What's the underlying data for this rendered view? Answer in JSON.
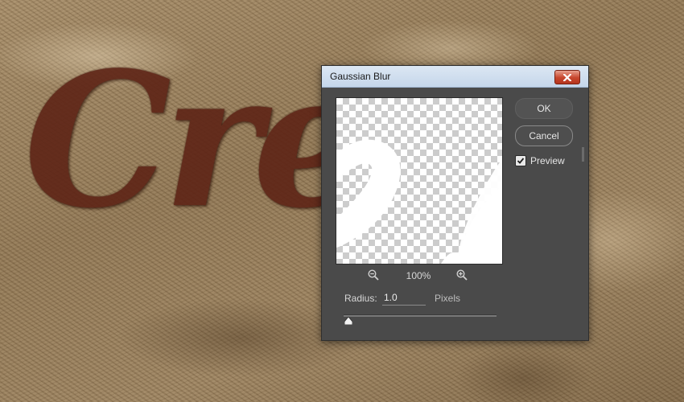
{
  "canvas": {
    "text": "Cre    e"
  },
  "dialog": {
    "title": "Gaussian Blur",
    "close_icon": "close-icon",
    "ok_label": "OK",
    "cancel_label": "Cancel",
    "preview_checkbox": {
      "label": "Preview",
      "checked": true
    },
    "zoom": {
      "level": "100%",
      "zoom_out_icon": "zoom-out-icon",
      "zoom_in_icon": "zoom-in-icon"
    },
    "radius": {
      "label": "Radius:",
      "value": "1.0",
      "unit": "Pixels",
      "slider_fraction": 0.01
    }
  },
  "colors": {
    "dialog_bg": "#4a4a4a",
    "titlebar": "#c5d6ea",
    "close_red": "#c7452c",
    "canvas_text": "#5e2416"
  }
}
